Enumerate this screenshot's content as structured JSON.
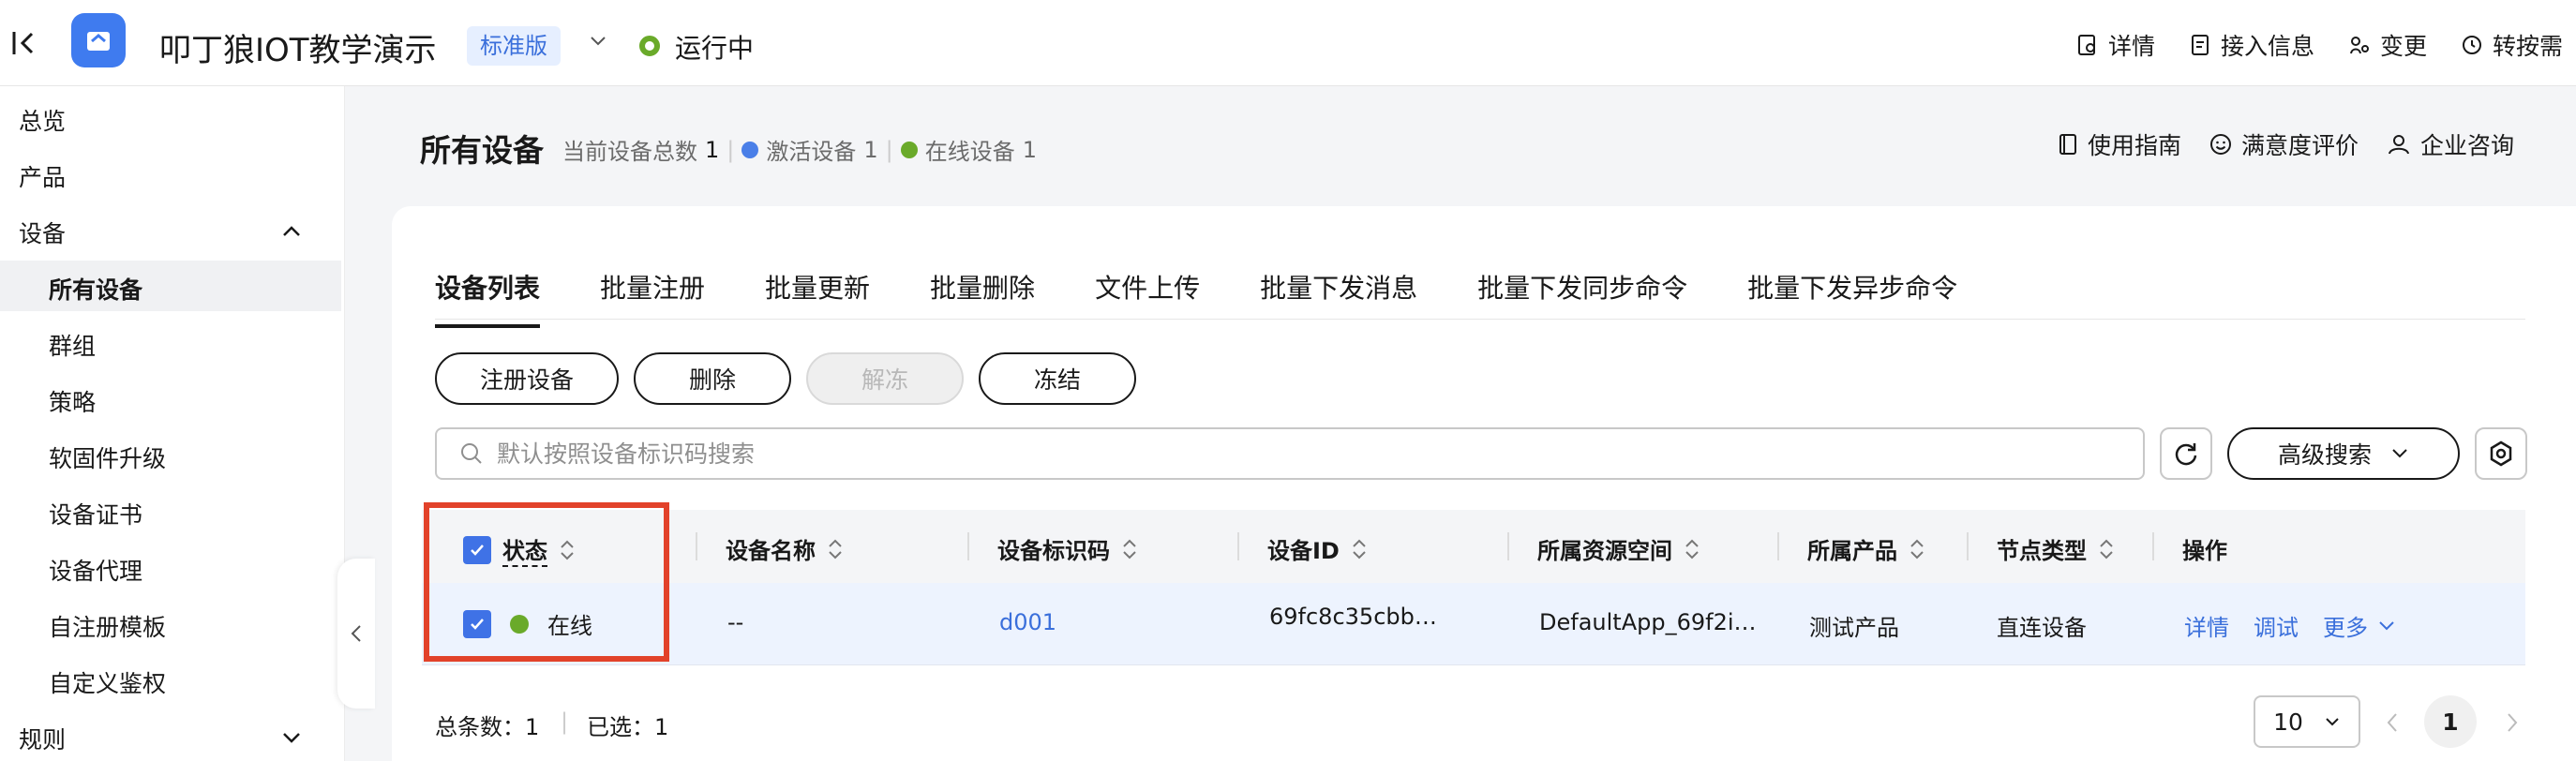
{
  "header": {
    "app_name": "叩丁狼IOT教学演示",
    "edition": "标准版",
    "status": "运行中",
    "status_color": "#6aaa2a",
    "actions": [
      {
        "label": "详情",
        "icon": "detail-search-icon"
      },
      {
        "label": "接入信息",
        "icon": "document-icon"
      },
      {
        "label": "变更",
        "icon": "change-icon"
      },
      {
        "label": "转按需",
        "icon": "history-clock-icon"
      }
    ]
  },
  "sidebar": {
    "items": [
      {
        "label": "总览"
      },
      {
        "label": "产品"
      },
      {
        "label": "设备",
        "expanded": true
      },
      {
        "label": "所有设备",
        "active": true
      },
      {
        "label": "群组"
      },
      {
        "label": "策略"
      },
      {
        "label": "软固件升级"
      },
      {
        "label": "设备证书"
      },
      {
        "label": "设备代理"
      },
      {
        "label": "自注册模板"
      },
      {
        "label": "自定义鉴权"
      },
      {
        "label": "规则",
        "expanded": false
      }
    ]
  },
  "page": {
    "title": "所有设备",
    "stats_total_label": "当前设备总数",
    "stats_total": "1",
    "stats_active_label": "激活设备",
    "stats_active": "1",
    "stats_online_label": "在线设备",
    "stats_online": "1",
    "active_color": "#3f72e6",
    "online_color": "#6aaa2a",
    "links": [
      {
        "label": "使用指南",
        "icon": "book-icon"
      },
      {
        "label": "满意度评价",
        "icon": "smile-icon"
      },
      {
        "label": "企业咨询",
        "icon": "consult-icon"
      }
    ]
  },
  "tabs": [
    "设备列表",
    "批量注册",
    "批量更新",
    "批量删除",
    "文件上传",
    "批量下发消息",
    "批量下发同步命令",
    "批量下发异步命令"
  ],
  "toolbar": {
    "register": "注册设备",
    "delete": "删除",
    "unfreeze": "解冻",
    "freeze": "冻结"
  },
  "search": {
    "placeholder": "默认按照设备标识码搜索",
    "advanced": "高级搜索"
  },
  "table": {
    "columns": [
      "状态",
      "设备名称",
      "设备标识码",
      "设备ID",
      "所属资源空间",
      "所属产品",
      "节点类型",
      "操作"
    ],
    "rows": [
      {
        "status": "在线",
        "name": "--",
        "identifier": "d001",
        "device_id": "69fc8c35cbb…",
        "space": "DefaultApp_69f2i…",
        "product": "测试产品",
        "node_type": "直连设备",
        "ops": [
          "详情",
          "调试",
          "更多"
        ]
      }
    ]
  },
  "footer": {
    "total_label": "总条数：",
    "total": "1",
    "selected_label": "已选：",
    "selected": "1",
    "page_size": "10",
    "current_page": "1"
  }
}
